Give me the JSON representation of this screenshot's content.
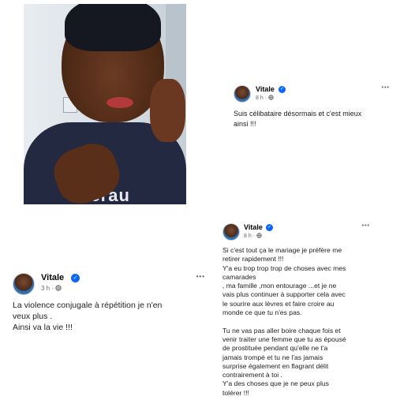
{
  "posts": [
    {
      "author": "Vitale",
      "time": "8 h",
      "text": "Suis célibataire désormais et c'est mieux\nainsi !!!"
    },
    {
      "author": "Vitale",
      "time": "3 h",
      "text": "La violence conjugale à répétition je n'en\nveux plus .\nAinsi va la vie !!!"
    },
    {
      "author": "Vitale",
      "time": "8 h",
      "text": "Si c'est tout ça le mariage je préfère me\nretirer rapidement !!!\nY'a eu trop trop trop de choses avec mes\ncamarades\n, ma famille ,mon entourage ...et je ne\nvais plus continuer à supporter cela avec\nle sourire aux lèvres et faire croire au\nmonde ce que tu n'es pas.\n\nTu ne vas pas aller boire chaque fois et\nvenir traiter une femme que tu as épousé\nde prostituée pendant qu'elle ne t'a\njamais trompé et tu ne l'as jamais\nsurprise également en flagrant délit\ncontrairement à toi .\nY'a des choses que je ne peux plus\ntolérer !!!"
    }
  ],
  "icons": {
    "verified": "verified-badge-icon",
    "globe": "globe-icon",
    "more": "more-options-icon"
  },
  "ui": {
    "dot_sep": "·",
    "more_glyph": "•••",
    "check_glyph": "✓"
  },
  "colors": {
    "verified": "#0866ff",
    "meta": "#65676b"
  }
}
